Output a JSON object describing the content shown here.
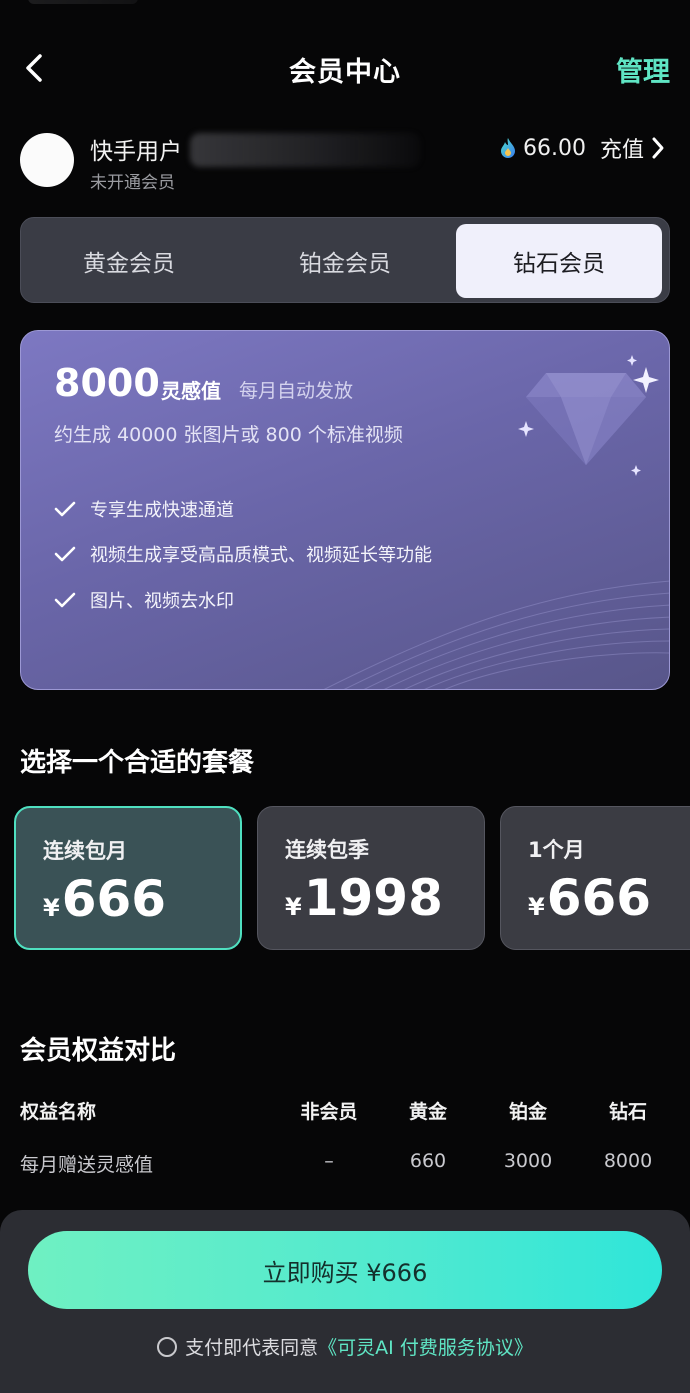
{
  "nav": {
    "title": "会员中心",
    "manage_label": "管理"
  },
  "user": {
    "name": "快手用户",
    "status": "未开通会员",
    "balance": "66.00",
    "recharge_label": "充值"
  },
  "tiers": [
    {
      "label": "黄金会员",
      "selected": false
    },
    {
      "label": "铂金会员",
      "selected": false
    },
    {
      "label": "钻石会员",
      "selected": true
    }
  ],
  "card": {
    "amount": "8000",
    "unit": "灵感值",
    "note": "每月自动发放",
    "approx": "约生成 40000 张图片或 800 个标准视频",
    "features": [
      "专享生成快速通道",
      "视频生成享受高品质模式、视频延长等功能",
      "图片、视频去水印"
    ]
  },
  "plans": {
    "title": "选择一个合适的套餐",
    "currency": "¥",
    "items": [
      {
        "name": "连续包月",
        "price": "666",
        "selected": true
      },
      {
        "name": "连续包季",
        "price": "1998",
        "selected": false
      },
      {
        "name": "1个月",
        "price": "666",
        "selected": false
      }
    ]
  },
  "compare": {
    "title": "会员权益对比",
    "headers": [
      "权益名称",
      "非会员",
      "黄金",
      "铂金",
      "钻石"
    ],
    "rows": [
      [
        "每月赠送灵感值",
        "–",
        "660",
        "3000",
        "8000"
      ]
    ]
  },
  "bottom": {
    "buy_label": "立即购买 ¥666",
    "agree_text": "支付即代表同意",
    "agree_link": "《可灵AI 付费服务协议》"
  },
  "colors": {
    "accent": "#5fe5c4",
    "background": "#060607",
    "card": "#6a66a9"
  },
  "icons": [
    "back-chevron-icon",
    "flame-drop-icon",
    "chevron-right-icon",
    "check-icon",
    "diamond-icon",
    "sparkle-icon",
    "radio-icon"
  ]
}
